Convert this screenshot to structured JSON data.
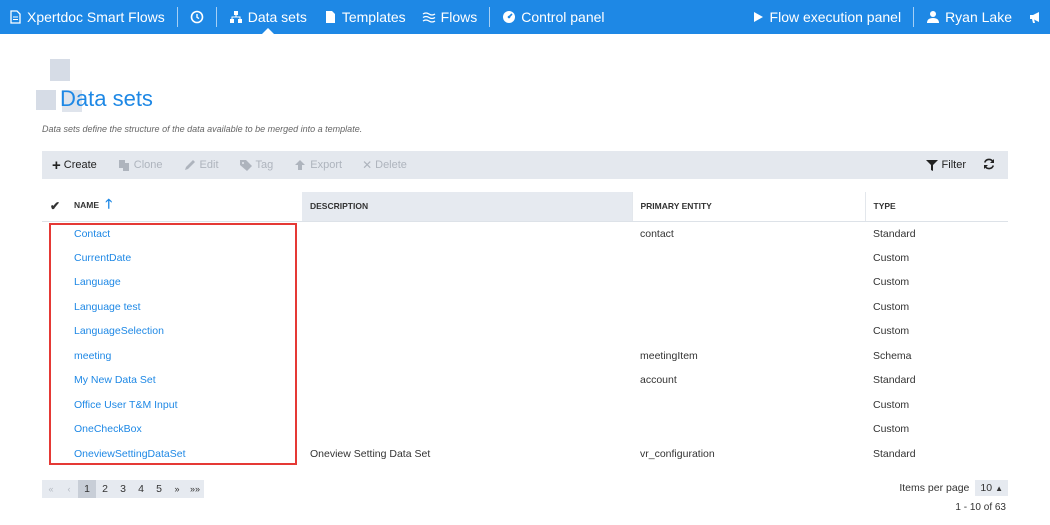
{
  "topbar": {
    "app_title": "Xpertdoc Smart Flows",
    "nav": {
      "datasets": "Data sets",
      "templates": "Templates",
      "flows": "Flows",
      "control_panel": "Control panel",
      "flow_execution": "Flow execution panel",
      "user": "Ryan Lake"
    }
  },
  "page": {
    "title": "Data sets",
    "subtitle": "Data sets define the structure of the data available to be merged into a template."
  },
  "toolbar": {
    "create": "Create",
    "clone": "Clone",
    "edit": "Edit",
    "tag": "Tag",
    "export": "Export",
    "delete": "Delete",
    "filter": "Filter"
  },
  "table": {
    "headers": {
      "name": "NAME",
      "description": "DESCRIPTION",
      "primary_entity": "PRIMARY ENTITY",
      "type": "TYPE"
    },
    "rows": [
      {
        "name": "Contact",
        "description": "",
        "entity": "contact",
        "type": "Standard"
      },
      {
        "name": "CurrentDate",
        "description": "",
        "entity": "",
        "type": "Custom"
      },
      {
        "name": "Language",
        "description": "",
        "entity": "",
        "type": "Custom"
      },
      {
        "name": "Language test",
        "description": "",
        "entity": "",
        "type": "Custom"
      },
      {
        "name": "LanguageSelection",
        "description": "",
        "entity": "",
        "type": "Custom"
      },
      {
        "name": "meeting",
        "description": "",
        "entity": "meetingItem",
        "type": "Schema"
      },
      {
        "name": "My New Data Set",
        "description": "",
        "entity": "account",
        "type": "Standard"
      },
      {
        "name": "Office User T&M Input",
        "description": "",
        "entity": "",
        "type": "Custom"
      },
      {
        "name": "OneCheckBox",
        "description": "",
        "entity": "",
        "type": "Custom"
      },
      {
        "name": "OneviewSettingDataSet",
        "description": "Oneview Setting Data Set",
        "entity": "vr_configuration",
        "type": "Standard"
      }
    ]
  },
  "pager": {
    "first": "«",
    "prev": "‹",
    "pages": [
      "1",
      "2",
      "3",
      "4",
      "5"
    ],
    "current_page": "1",
    "next": "»",
    "last": "»»",
    "items_per_page_label": "Items per page",
    "items_per_page": "10",
    "range": "1 - 10 of 63"
  },
  "colors": {
    "primary": "#1e88e5",
    "highlight": "#e53935"
  }
}
